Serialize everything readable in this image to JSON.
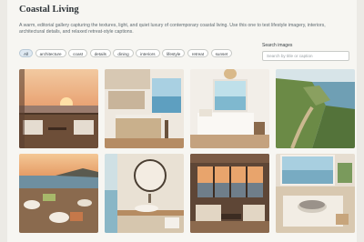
{
  "gallery": {
    "title": "Coastal Living",
    "description": "A warm, editorial gallery capturing the textures, light, and quiet luxury of contemporary coastal living. Use this one to test lifestyle imagery, interiors, architectural details, and relaxed retreat-style captions."
  },
  "filters": [
    "All",
    "architecture",
    "coast",
    "details",
    "dining",
    "interiors",
    "lifestyle",
    "retreat",
    "sunset"
  ],
  "active_filter": "All",
  "search": {
    "label": "Search images",
    "placeholder": "Search by title or caption"
  },
  "images": [
    {
      "id": "sunset-terrace"
    },
    {
      "id": "kitchen-ocean-view"
    },
    {
      "id": "bedroom-ocean-view"
    },
    {
      "id": "coastal-cliff-path"
    },
    {
      "id": "seaside-dining-table"
    },
    {
      "id": "bathroom-round-mirror"
    },
    {
      "id": "living-room-sunset"
    },
    {
      "id": "window-bowl-detail"
    }
  ],
  "colors": {
    "accent_chip": "#dfe9f2",
    "title": "#2e3438",
    "text": "#5f6a70"
  }
}
